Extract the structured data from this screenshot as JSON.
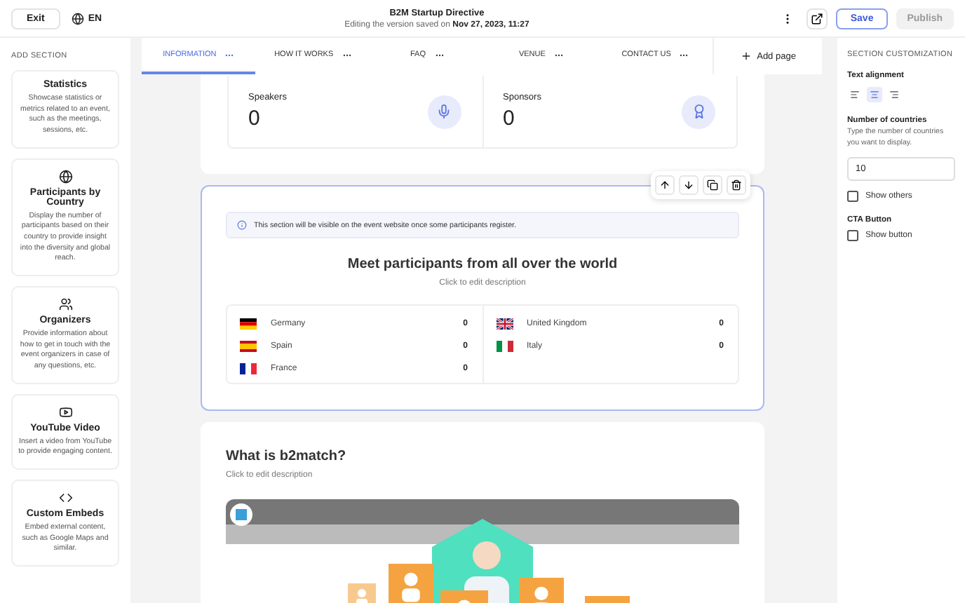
{
  "header": {
    "exit": "Exit",
    "language": "EN",
    "title": "B2M Startup Directive",
    "subtitle": "Editing the version saved on **Nov 27, 2023, 11:27**",
    "save": "Save",
    "publish": {
      "label": "Publish",
      "disabled": true
    }
  },
  "sidebar": {
    "title": "ADD SECTION",
    "items": [
      {
        "title": "Statistics",
        "description": "Showcase statistics or metrics related to an event, such as the meetings, sessions, etc."
      },
      {
        "title": "Participants by Country",
        "description": "Display the number of participants based on their country to provide insight into the diversity and global reach."
      },
      {
        "title": "Organizers",
        "description": "Provide information about how to get in touch with the event organizers in case of any questions, etc."
      },
      {
        "title": "YouTube Video",
        "description": "Insert a video from YouTube to provide engaging content."
      },
      {
        "title": "Custom Embeds",
        "description": "Embed external content, such as Google Maps and similar."
      }
    ]
  },
  "tabs": [
    {
      "label": "INFORMATION",
      "selected": true
    },
    {
      "label": "HOW IT WORKS",
      "selected": false
    },
    {
      "label": "FAQ",
      "selected": false
    },
    {
      "label": "VENUE",
      "selected": false
    },
    {
      "label": "CONTACT US",
      "selected": false
    }
  ],
  "add_page": "Add page",
  "stats": [
    {
      "label": "Speakers",
      "value": "0"
    },
    {
      "label": "Sponsors",
      "value": "0"
    }
  ],
  "countries_section": {
    "notice": "This section will be visible on the event website once some participants register.",
    "heading": "Meet participants from all over the world",
    "description": "Click to edit description",
    "columns": [
      [
        {
          "name": "Germany",
          "count": "0"
        },
        {
          "name": "Spain",
          "count": "0"
        },
        {
          "name": "France",
          "count": "0"
        }
      ],
      [
        {
          "name": "United Kingdom",
          "count": "0"
        },
        {
          "name": "Italy",
          "count": "0"
        }
      ]
    ]
  },
  "video_section": {
    "heading": "What is b2match?",
    "description": "Click to edit description"
  },
  "customization": {
    "title": "SECTION CUSTOMIZATION",
    "alignment_label": "Text alignment",
    "alignments": [
      {
        "selected": false
      },
      {
        "selected": true
      },
      {
        "selected": false
      }
    ],
    "countries_label": "Number of countries",
    "countries_hint": "Type the number of countries you want to display.",
    "countries_value": "10",
    "show_others": {
      "label": "Show others",
      "checked": false
    },
    "cta_title": "CTA Button",
    "show_button": {
      "label": "Show button",
      "checked": false
    }
  }
}
